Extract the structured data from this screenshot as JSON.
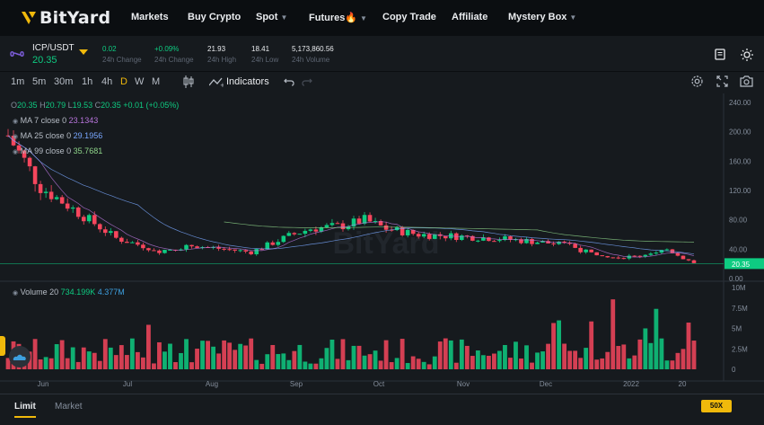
{
  "nav": {
    "brand": "BitYard",
    "items": [
      {
        "label": "Markets",
        "dropdown": false
      },
      {
        "label": "Buy Crypto",
        "dropdown": false
      },
      {
        "label": "Spot",
        "dropdown": true
      },
      {
        "label": "Futures🔥",
        "dropdown": true
      },
      {
        "label": "Copy Trade",
        "dropdown": false
      },
      {
        "label": "Affiliate",
        "dropdown": false
      },
      {
        "label": "Mystery Box",
        "dropdown": true
      }
    ]
  },
  "ticker": {
    "pair": "ICP/USDT",
    "price": "20.35",
    "stats": [
      {
        "value": "0.02",
        "label": "24h Change",
        "color": "#0ecb81"
      },
      {
        "value": "+0.09%",
        "label": "24h Change",
        "color": "#0ecb81"
      },
      {
        "value": "21.93",
        "label": "24h High",
        "color": "#eaecef"
      },
      {
        "value": "18.41",
        "label": "24h Low",
        "color": "#eaecef"
      },
      {
        "value": "5,173,860.56",
        "label": "24h Volume",
        "color": "#eaecef"
      }
    ]
  },
  "toolbar": {
    "timeframes": [
      "1m",
      "5m",
      "30m",
      "1h",
      "4h",
      "D",
      "W",
      "M"
    ],
    "active_timeframe": "D",
    "indicators_label": "Indicators"
  },
  "legend": {
    "ohlc_prefix_o": "O",
    "open": "20.35",
    "ohlc_prefix_h": "H",
    "high": "20.79",
    "ohlc_prefix_l": "L",
    "low": "19.53",
    "ohlc_prefix_c": "C",
    "close": "20.35",
    "change": "+0.01 (+0.05%)",
    "ma7_label": "MA 7 close 0",
    "ma7_value": "23.1343",
    "ma25_label": "MA 25 close 0",
    "ma25_value": "29.1956",
    "ma99_label": "MA 99 close 0",
    "ma99_value": "35.7681",
    "volume_label": "Volume 20",
    "volume_value_1": "734.199K",
    "volume_value_2": "4.377M"
  },
  "colors": {
    "up": "#0ecb81",
    "down": "#f6465d",
    "accent": "#f0b90b",
    "ma7": "#b875dc",
    "ma25": "#79a7ff",
    "ma99": "#8fd58a"
  },
  "chart_data": {
    "type": "candlestick",
    "price_axis_ticks": [
      "240.00",
      "200.00",
      "160.00",
      "120.00",
      "80.00",
      "40.00",
      "0.00"
    ],
    "current_price_label": "20.35",
    "volume_axis_ticks": [
      "10M",
      "7.5M",
      "5M",
      "2.5M",
      "0"
    ],
    "x_axis_labels": [
      "Jun",
      "Jul",
      "Aug",
      "Sep",
      "Oct",
      "Nov",
      "Dec",
      "2022",
      "20"
    ],
    "watermark": "BitYard"
  },
  "bottom": {
    "tab_limit": "Limit",
    "tab_market": "Market",
    "leverage": "50X"
  },
  "icons": [
    "logo-icon",
    "infinity-icon",
    "chevron-down-icon",
    "book-icon",
    "sun-icon",
    "candle-type-icon",
    "indicators-icon",
    "undo-icon",
    "redo-icon",
    "settings-icon",
    "fullscreen-icon",
    "camera-icon",
    "drawing-cloud-icon"
  ]
}
